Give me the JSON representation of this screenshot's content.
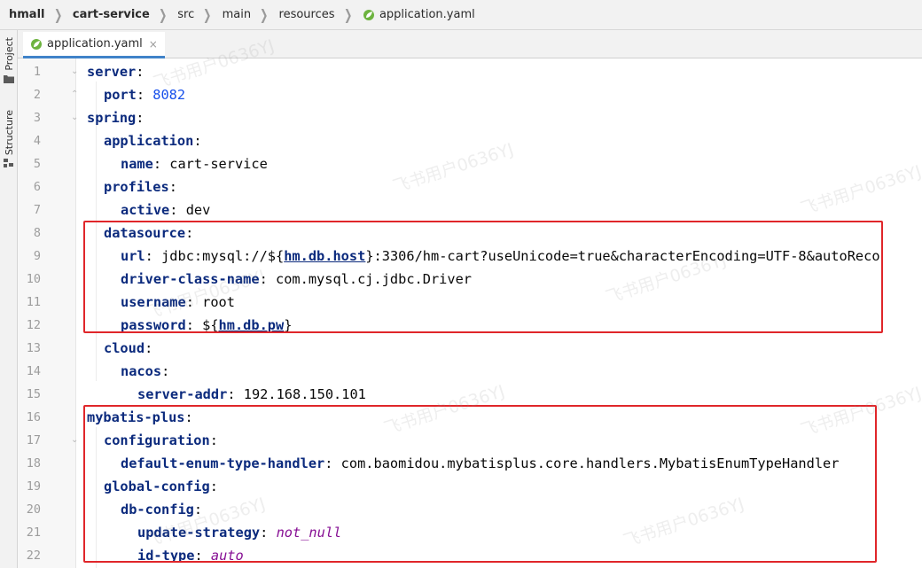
{
  "breadcrumb": [
    "hmall",
    "cart-service",
    "src",
    "main",
    "resources",
    "application.yaml"
  ],
  "tool_tabs": {
    "project": "Project",
    "structure": "Structure"
  },
  "editor_tab": {
    "label": "application.yaml",
    "close": "×"
  },
  "line_numbers": [
    "1",
    "2",
    "3",
    "4",
    "5",
    "6",
    "7",
    "8",
    "9",
    "10",
    "11",
    "12",
    "13",
    "14",
    "15",
    "16",
    "17",
    "18",
    "19",
    "20",
    "21",
    "22"
  ],
  "code": {
    "l1": {
      "key": "server",
      "colon": ":"
    },
    "l2": {
      "key": "port",
      "colon": ": ",
      "value": "8082"
    },
    "l3": {
      "key": "spring",
      "colon": ":"
    },
    "l4": {
      "key": "application",
      "colon": ":"
    },
    "l5": {
      "key": "name",
      "colon": ": ",
      "value": "cart-service"
    },
    "l6": {
      "key": "profiles",
      "colon": ":"
    },
    "l7": {
      "key": "active",
      "colon": ": ",
      "value": "dev"
    },
    "l8": {
      "key": "datasource",
      "colon": ":"
    },
    "l9": {
      "key": "url",
      "colon": ": ",
      "prefix": "jdbc:mysql://${",
      "placeholder": "hm.db.host",
      "suffix": "}:3306/hm-cart?useUnicode=true&characterEncoding=UTF-8&autoReco"
    },
    "l10": {
      "key": "driver-class-name",
      "colon": ": ",
      "value": "com.mysql.cj.jdbc.Driver"
    },
    "l11": {
      "key": "username",
      "colon": ": ",
      "value": "root"
    },
    "l12": {
      "key": "password",
      "colon": ": ",
      "prefix": "${",
      "placeholder": "hm.db.pw",
      "suffix": "}"
    },
    "l13": {
      "key": "cloud",
      "colon": ":"
    },
    "l14": {
      "key": "nacos",
      "colon": ":"
    },
    "l15": {
      "key": "server-addr",
      "colon": ": ",
      "value": "192.168.150.101"
    },
    "l16": {
      "key": "mybatis-plus",
      "colon": ":"
    },
    "l17": {
      "key": "configuration",
      "colon": ":"
    },
    "l18": {
      "key": "default-enum-type-handler",
      "colon": ": ",
      "value": "com.baomidou.mybatisplus.core.handlers.MybatisEnumTypeHandler"
    },
    "l19": {
      "key": "global-config",
      "colon": ":"
    },
    "l20": {
      "key": "db-config",
      "colon": ":"
    },
    "l21": {
      "key": "update-strategy",
      "colon": ": ",
      "value": "not_null"
    },
    "l22": {
      "key": "id-type",
      "colon": ": ",
      "value": "auto"
    }
  },
  "watermark": "飞书用户0636YJ",
  "colors": {
    "key": "#0b2a7d",
    "number": "#1750eb",
    "enum_value": "#871094",
    "annotation": "#e0262a",
    "tab_underline": "#4083c9"
  }
}
